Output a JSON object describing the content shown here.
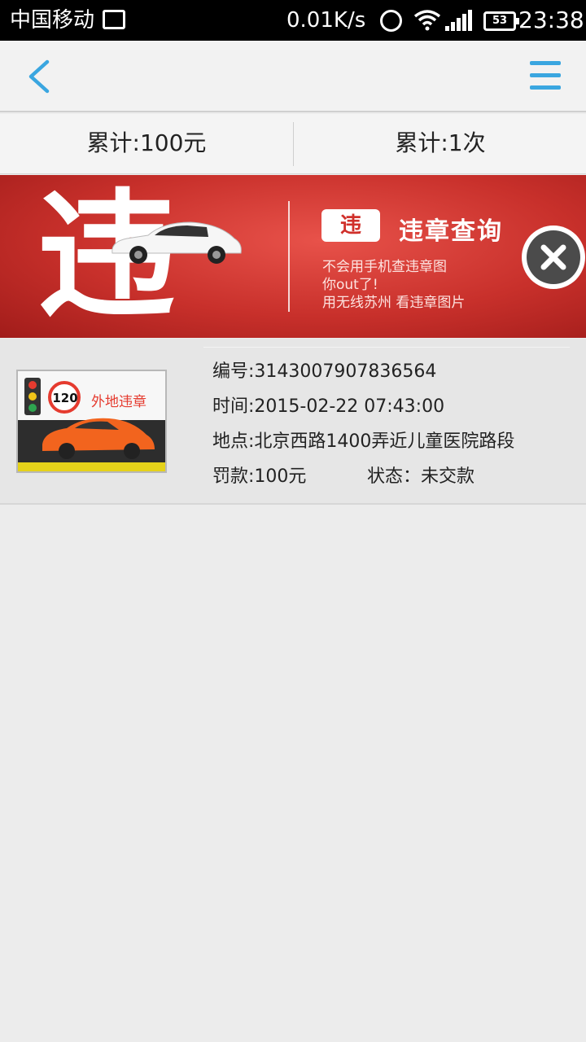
{
  "statusbar": {
    "carrier": "中国移动",
    "speed": "0.01K/s",
    "battery": "53",
    "time": "23:38"
  },
  "summary": {
    "total_amount": "累计:100元",
    "total_count": "累计:1次"
  },
  "banner": {
    "big_char": "违",
    "logo_char": "违",
    "logo_text": "违章查询",
    "line1": "不会用手机查违章图",
    "line2": "你out了!",
    "line3": "用无线苏州 看违章图片",
    "accent_color": "#c8302b"
  },
  "record": {
    "thumb": {
      "speed_limit": "120",
      "label": "外地违章"
    },
    "number": "编号:3143007907836564",
    "time": "时间:2015-02-22 07:43:00",
    "location": "地点:北京西路1400弄近儿童医院路段",
    "fine": "罚款:100元",
    "status": "状态：未交款"
  },
  "colors": {
    "nav_accent": "#3aa6e0",
    "background": "#ececec"
  }
}
